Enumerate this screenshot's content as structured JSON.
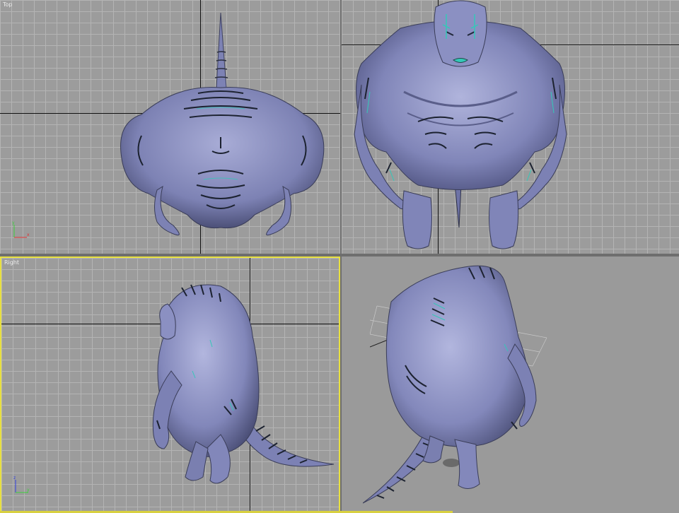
{
  "app": {
    "name": "3D modeling viewports"
  },
  "viewports": {
    "top": {
      "label": "Top"
    },
    "front": {
      "label": ""
    },
    "right": {
      "label": "Right",
      "active": true
    },
    "perspective": {
      "label": ""
    }
  },
  "axis_tripod": {
    "x": "x",
    "y": "y",
    "z": "z"
  },
  "colors": {
    "viewport_bg": "#9c9c9c",
    "grid_line": "#b4b4b4",
    "active_border": "#e8e040",
    "model_skin": "#8a8fbf",
    "model_stripes": "#1f4a48",
    "model_glow": "#34c8b8"
  }
}
